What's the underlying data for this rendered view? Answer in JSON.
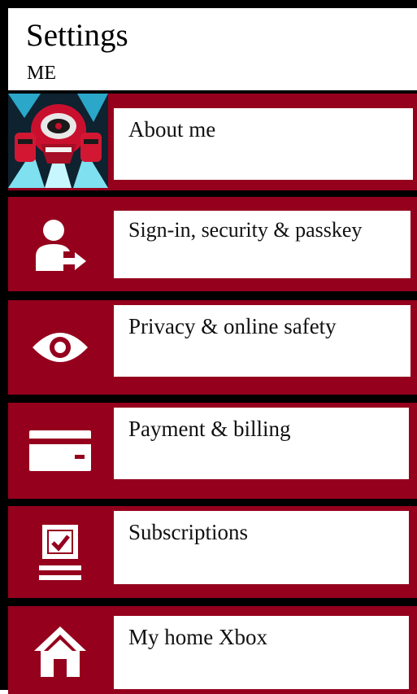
{
  "header": {
    "title": "Settings",
    "subtitle": "ME"
  },
  "items": [
    {
      "label": "About me",
      "icon": "avatar-image"
    },
    {
      "label": "Sign-in, security & passkey",
      "icon": "user-signin-icon"
    },
    {
      "label": "Privacy & online safety",
      "icon": "eye-icon"
    },
    {
      "label": "Payment & billing",
      "icon": "credit-card-icon"
    },
    {
      "label": "Subscriptions",
      "icon": "checklist-icon"
    },
    {
      "label": "My home Xbox",
      "icon": "home-icon"
    }
  ],
  "colors": {
    "accent": "#95001d",
    "background": "#ffffff",
    "border": "#000000"
  }
}
